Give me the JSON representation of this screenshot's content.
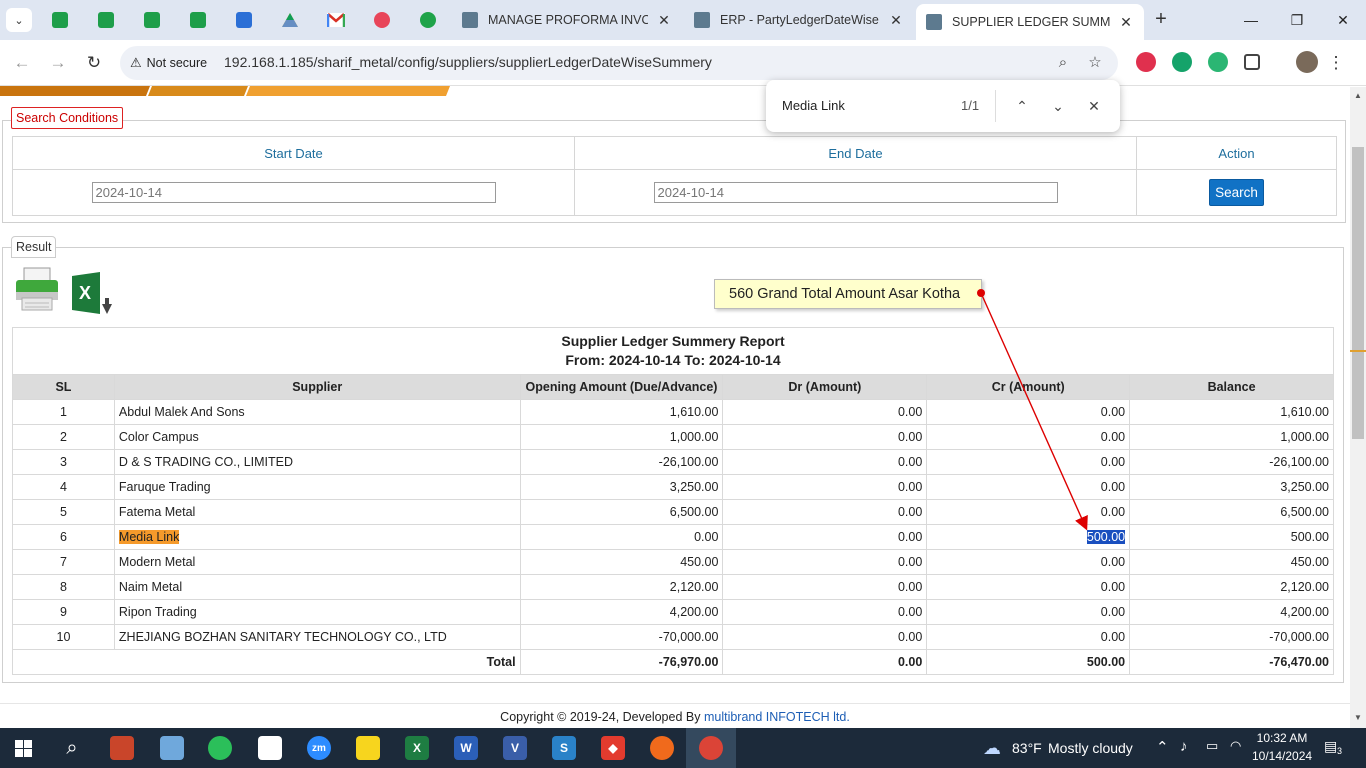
{
  "browser": {
    "tabs": [
      {
        "title": "MANAGE PROFORMA INVOIC",
        "close": "✕"
      },
      {
        "title": "ERP - PartyLedgerDateWise Su",
        "close": "✕"
      },
      {
        "title": "SUPPLIER LEDGER SUMMERY",
        "close": "✕"
      }
    ],
    "new_tab": "+",
    "window_controls": {
      "minimize": "—",
      "maximize": "❐",
      "close": "✕"
    },
    "security_label": "Not secure",
    "url": "192.168.1.185/sharif_metal/config/suppliers/supplierLedgerDateWiseSummery"
  },
  "find_bar": {
    "query": "Media Link",
    "count": "1/1"
  },
  "search_conditions": {
    "legend": "Search Conditions",
    "start_date_label": "Start Date",
    "end_date_label": "End Date",
    "action_label": "Action",
    "start_date": "2024-10-14",
    "end_date": "2024-10-14",
    "search_button": "Search"
  },
  "result": {
    "legend": "Result"
  },
  "callout": {
    "text": "560 Grand Total Amount Asar Kotha"
  },
  "report": {
    "title": "Supplier Ledger Summery Report",
    "subtitle": "From: 2024-10-14 To: 2024-10-14",
    "columns": [
      "SL",
      "Supplier",
      "Opening Amount (Due/Advance)",
      "Dr (Amount)",
      "Cr (Amount)",
      "Balance"
    ],
    "rows": [
      {
        "sl": "1",
        "supplier": "Abdul Malek And Sons",
        "opening": "1,610.00",
        "dr": "0.00",
        "cr": "0.00",
        "balance": "1,610.00"
      },
      {
        "sl": "2",
        "supplier": "Color Campus",
        "opening": "1,000.00",
        "dr": "0.00",
        "cr": "0.00",
        "balance": "1,000.00"
      },
      {
        "sl": "3",
        "supplier": "D & S TRADING CO., LIMITED",
        "opening": "-26,100.00",
        "dr": "0.00",
        "cr": "0.00",
        "balance": "-26,100.00"
      },
      {
        "sl": "4",
        "supplier": "Faruque Trading",
        "opening": "3,250.00",
        "dr": "0.00",
        "cr": "0.00",
        "balance": "3,250.00"
      },
      {
        "sl": "5",
        "supplier": "Fatema Metal",
        "opening": "6,500.00",
        "dr": "0.00",
        "cr": "0.00",
        "balance": "6,500.00"
      },
      {
        "sl": "6",
        "supplier": "Media Link",
        "opening": "0.00",
        "dr": "0.00",
        "cr": "500.00",
        "balance": "500.00"
      },
      {
        "sl": "7",
        "supplier": "Modern Metal",
        "opening": "450.00",
        "dr": "0.00",
        "cr": "0.00",
        "balance": "450.00"
      },
      {
        "sl": "8",
        "supplier": "Naim Metal",
        "opening": "2,120.00",
        "dr": "0.00",
        "cr": "0.00",
        "balance": "2,120.00"
      },
      {
        "sl": "9",
        "supplier": "Ripon Trading",
        "opening": "4,200.00",
        "dr": "0.00",
        "cr": "0.00",
        "balance": "4,200.00"
      },
      {
        "sl": "10",
        "supplier": "ZHEJIANG BOZHAN SANITARY TECHNOLOGY CO., LTD",
        "opening": "-70,000.00",
        "dr": "0.00",
        "cr": "0.00",
        "balance": "-70,000.00"
      }
    ],
    "total": {
      "label": "Total",
      "opening": "-76,970.00",
      "dr": "0.00",
      "cr": "500.00",
      "balance": "-76,470.00"
    }
  },
  "footer": {
    "prefix": "Copyright © 2019-24, Developed By ",
    "link": "multibrand INFOTECH ltd."
  },
  "taskbar": {
    "temperature": "83°F",
    "weather": "Mostly cloudy",
    "time": "10:32 AM",
    "date": "10/14/2024",
    "notifications": "3"
  },
  "colors": {
    "accent_blue": "#1172c5",
    "legend_red": "#c00",
    "highlight_orange": "#f59a2b",
    "selection_blue": "#1a4fbf",
    "arrow_red": "#d00"
  }
}
